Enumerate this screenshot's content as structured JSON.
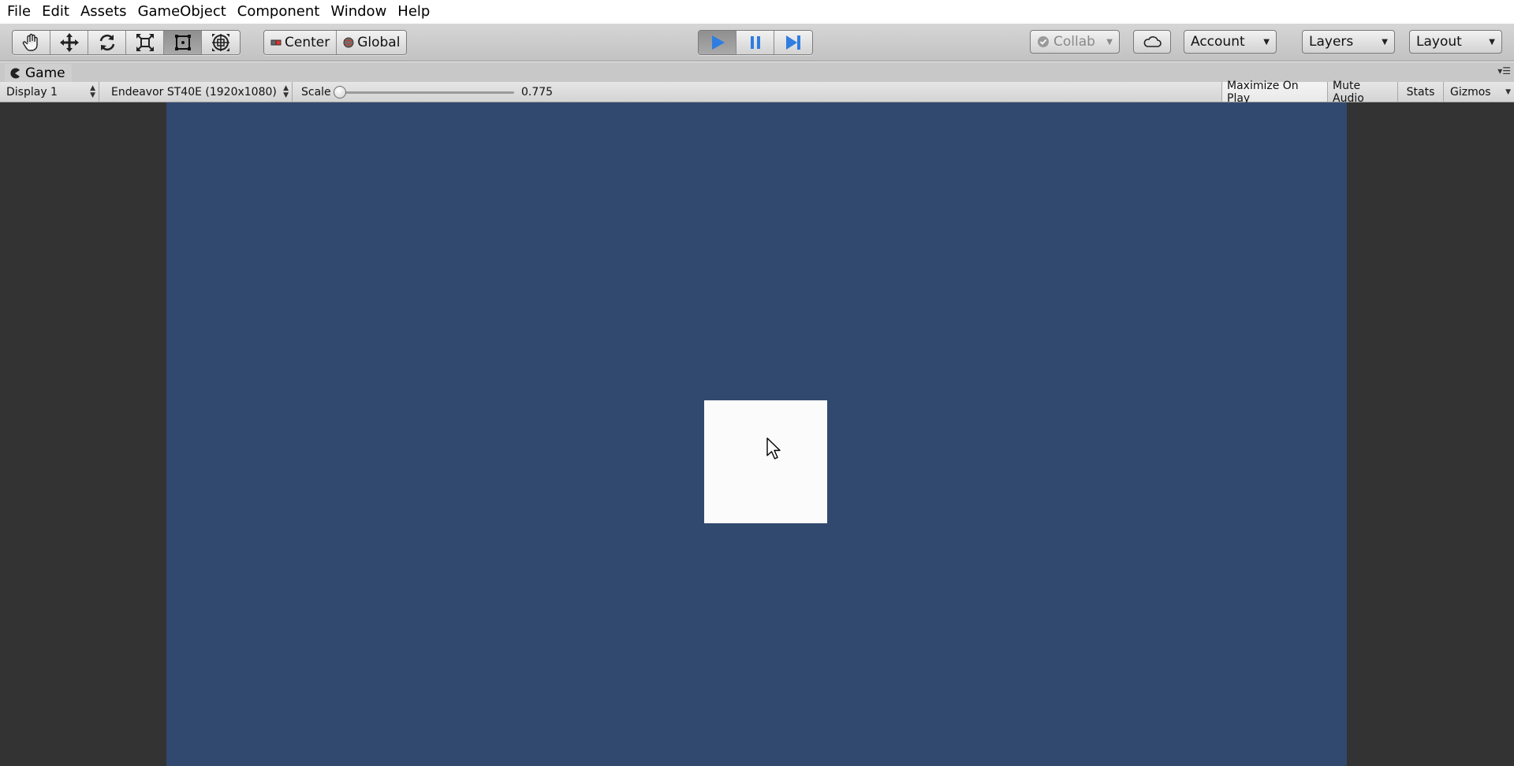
{
  "menu": [
    "File",
    "Edit",
    "Assets",
    "GameObject",
    "Component",
    "Window",
    "Help"
  ],
  "toolbar": {
    "tools": [
      {
        "icon": "hand-icon"
      },
      {
        "icon": "move-icon"
      },
      {
        "icon": "rotate-icon"
      },
      {
        "icon": "scale-icon"
      },
      {
        "icon": "rect-tool-icon",
        "active": true
      },
      {
        "icon": "transform-tool-icon"
      }
    ],
    "pivot": {
      "center_label": "Center",
      "global_label": "Global"
    },
    "playback": {
      "play_icon": "play-icon",
      "pause_icon": "pause-icon",
      "step_icon": "step-icon",
      "playing": true
    },
    "collab_label": "Collab",
    "cloud_icon": "cloud-icon",
    "account_label": "Account",
    "layers_label": "Layers",
    "layout_label": "Layout"
  },
  "game_tab": {
    "title": "Game",
    "icon": "pacman-icon"
  },
  "game_bar": {
    "display": "Display 1",
    "resolution": "Endeavor ST40E (1920x1080)",
    "scale_label": "Scale",
    "scale_value": "0.775",
    "scale_fraction": 0.0,
    "maximize_on_play": "Maximize On Play",
    "mute_audio": "Mute Audio",
    "stats": "Stats",
    "gizmos": "Gizmos"
  },
  "colors": {
    "game_background": "#31496f",
    "letterbox": "#333333",
    "square": "#fbfbfb",
    "play_blue": "#2f7de1"
  }
}
